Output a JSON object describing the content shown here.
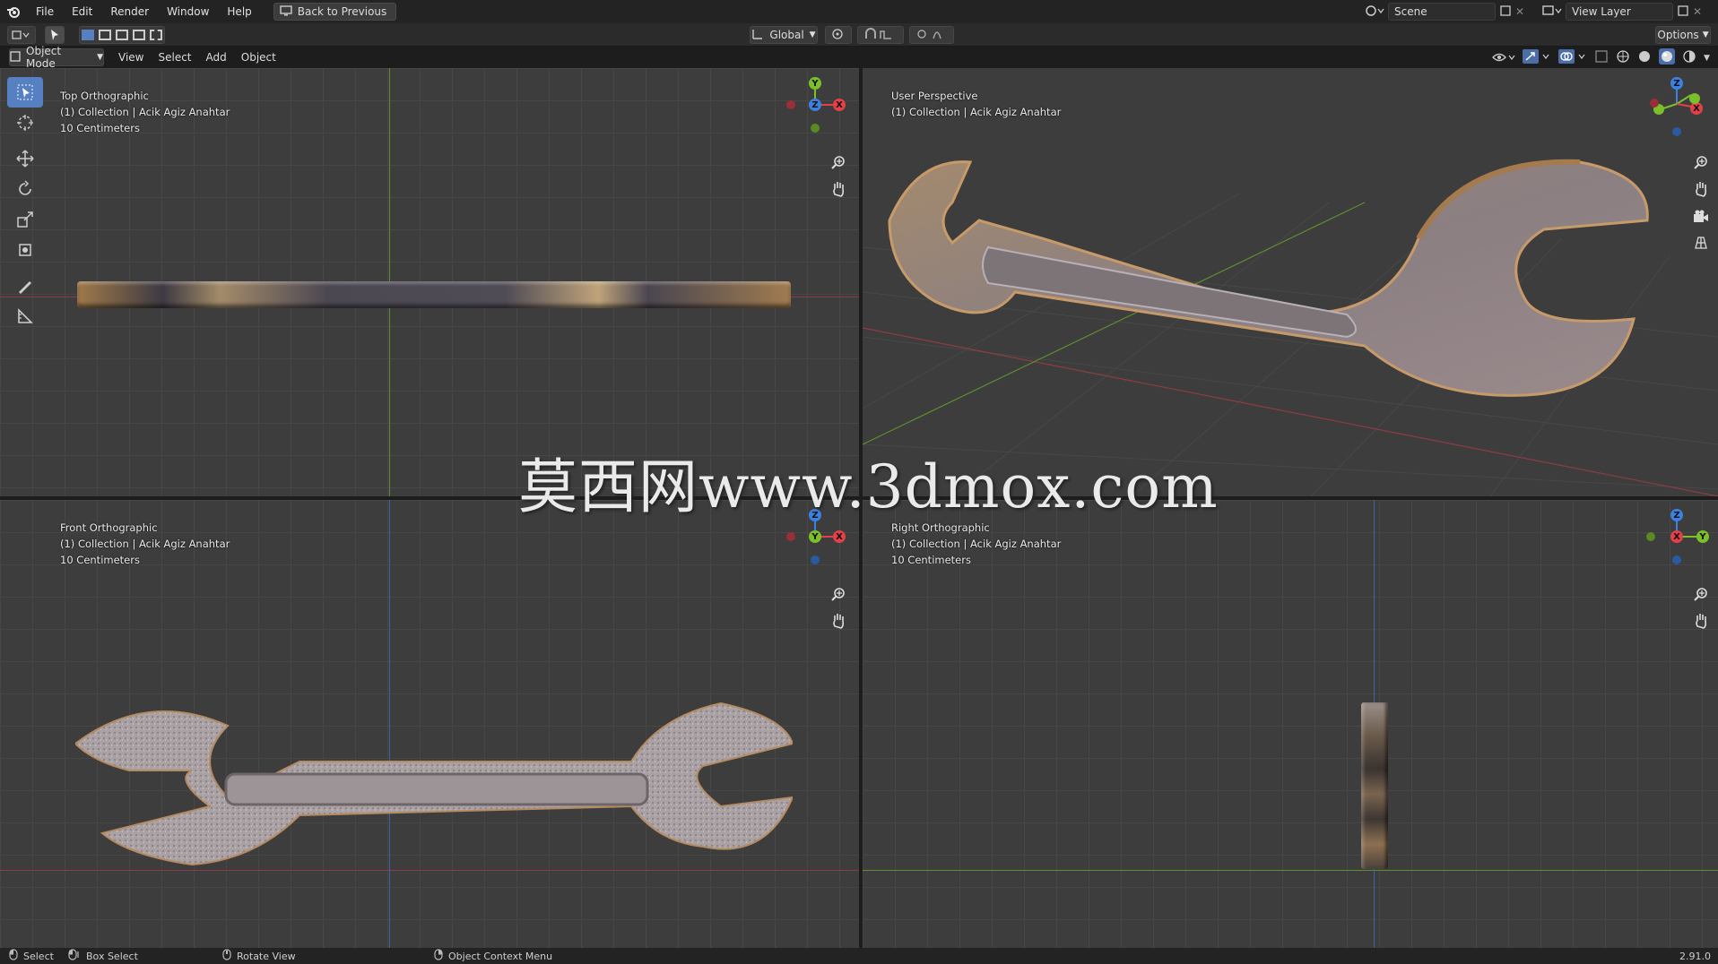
{
  "menu": {
    "items": [
      "File",
      "Edit",
      "Render",
      "Window",
      "Help"
    ],
    "back_button": "Back to Previous"
  },
  "scene": {
    "name": "Scene",
    "view_layer": "View Layer"
  },
  "header": {
    "mode": "Object Mode",
    "view": "View",
    "select": "Select",
    "add": "Add",
    "object": "Object",
    "orientation": "Global",
    "options": "Options"
  },
  "viewports": {
    "top": {
      "title": "Top Orthographic",
      "collection": "(1) Collection | Acik Agiz Anahtar",
      "scale": "10 Centimeters"
    },
    "user": {
      "title": "User Perspective",
      "collection": "(1) Collection | Acik Agiz Anahtar"
    },
    "front": {
      "title": "Front Orthographic",
      "collection": "(1) Collection | Acik Agiz Anahtar",
      "scale": "10 Centimeters"
    },
    "right": {
      "title": "Right Orthographic",
      "collection": "(1) Collection | Acik Agiz Anahtar",
      "scale": "10 Centimeters"
    }
  },
  "axes": {
    "x": "X",
    "y": "Y",
    "z": "Z"
  },
  "colors": {
    "x_axis": "#e4404a",
    "y_axis": "#7bbf2a",
    "z_axis": "#3b82e0",
    "active_tool": "#5680c2"
  },
  "status": {
    "select": "Select",
    "box_select": "Box Select",
    "rotate_view": "Rotate View",
    "context_menu": "Object Context Menu",
    "version": "2.91.0"
  },
  "watermark": "莫西网www.3dmox.com"
}
